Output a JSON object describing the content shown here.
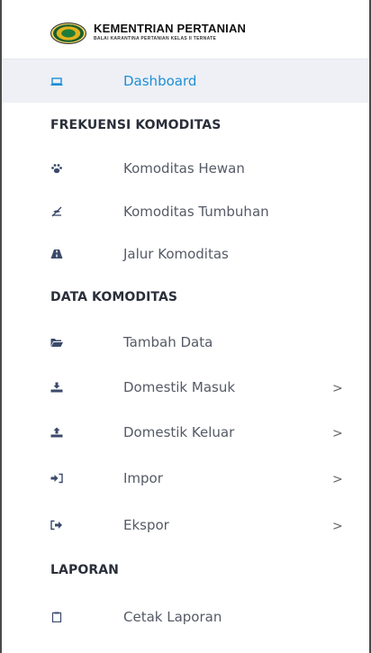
{
  "brand": {
    "title": "KEMENTRIAN PERTANIAN",
    "subtitle": "BALAI KARANTINA PERTANIAN KELAS II TERNATE"
  },
  "nav": {
    "dashboard": {
      "label": "Dashboard",
      "icon": "laptop-icon",
      "active": true
    },
    "sections": [
      {
        "heading": "FREKUENSI KOMODITAS",
        "items": [
          {
            "label": "Komoditas Hewan",
            "icon": "paw-icon"
          },
          {
            "label": "Komoditas Tumbuhan",
            "icon": "leaf-icon"
          },
          {
            "label": "Jalur Komoditas",
            "icon": "road-icon"
          }
        ]
      },
      {
        "heading": "DATA KOMODITAS",
        "items": [
          {
            "label": "Tambah Data",
            "icon": "folder-open-icon"
          },
          {
            "label": "Domestik Masuk",
            "icon": "download-icon",
            "chevron": ">"
          },
          {
            "label": "Domestik Keluar",
            "icon": "upload-icon",
            "chevron": ">"
          },
          {
            "label": "Impor",
            "icon": "sign-in-icon",
            "chevron": ">"
          },
          {
            "label": "Ekspor",
            "icon": "sign-out-icon",
            "chevron": ">"
          }
        ]
      },
      {
        "heading": "LAPORAN",
        "items": [
          {
            "label": "Cetak Laporan",
            "icon": "clipboard-icon"
          }
        ]
      }
    ]
  },
  "colors": {
    "active_text": "#1e8fd6",
    "active_bg": "#eef0f5",
    "icon": "#3b4a6b"
  }
}
